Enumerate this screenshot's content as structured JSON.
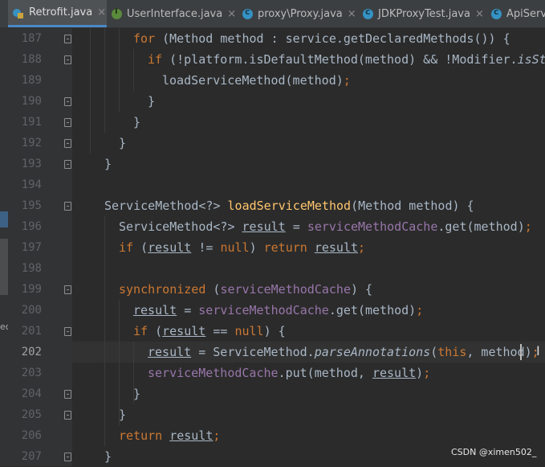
{
  "tabs": [
    {
      "label": "Retrofit.java",
      "active": true,
      "icon": "retrofit-class-icon",
      "closable": true
    },
    {
      "label": "UserInterface.java",
      "active": false,
      "icon": "interface-icon",
      "closable": true
    },
    {
      "label": "proxy\\Proxy.java",
      "active": false,
      "icon": "class-icon",
      "closable": true
    },
    {
      "label": "JDKProxyTest.java",
      "active": false,
      "icon": "class-icon",
      "closable": true
    },
    {
      "label": "ApiServ",
      "active": false,
      "icon": "class-icon",
      "closable": false
    }
  ],
  "left_strip": {
    "partial_text": "ec"
  },
  "editor": {
    "current_line": "202",
    "lines": [
      {
        "n": "187",
        "tokens": [
          {
            "t": "for",
            "c": "kw"
          },
          {
            "t": " (Method method : service.getDeclaredMethods()) {"
          }
        ]
      },
      {
        "n": "188",
        "tokens": [
          {
            "t": "if",
            "c": "kw"
          },
          {
            "t": " (!platform.isDefaultMethod(method) && !Modifier."
          },
          {
            "t": "isStat",
            "c": "stat"
          }
        ]
      },
      {
        "n": "189",
        "tokens": [
          {
            "t": "loadServiceMethod(method)"
          },
          {
            "t": ";",
            "c": "kw"
          }
        ]
      },
      {
        "n": "190",
        "tokens": [
          {
            "t": "}"
          }
        ]
      },
      {
        "n": "191",
        "tokens": [
          {
            "t": "}"
          }
        ]
      },
      {
        "n": "192",
        "tokens": [
          {
            "t": "}"
          }
        ]
      },
      {
        "n": "193",
        "tokens": [
          {
            "t": "}"
          }
        ]
      },
      {
        "n": "194",
        "tokens": []
      },
      {
        "n": "195",
        "tokens": [
          {
            "t": "ServiceMethod<?> "
          },
          {
            "t": "loadServiceMethod",
            "c": "mth"
          },
          {
            "t": "(Method method) {"
          }
        ]
      },
      {
        "n": "196",
        "tokens": [
          {
            "t": "ServiceMethod<?> "
          },
          {
            "t": "result",
            "c": "lv"
          },
          {
            "t": " = "
          },
          {
            "t": "serviceMethodCache",
            "c": "fld"
          },
          {
            "t": ".get(method)"
          },
          {
            "t": ";",
            "c": "kw"
          }
        ]
      },
      {
        "n": "197",
        "tokens": [
          {
            "t": "if",
            "c": "kw"
          },
          {
            "t": " ("
          },
          {
            "t": "result",
            "c": "lv"
          },
          {
            "t": " != "
          },
          {
            "t": "null",
            "c": "kw"
          },
          {
            "t": ") "
          },
          {
            "t": "return",
            "c": "kw"
          },
          {
            "t": " "
          },
          {
            "t": "result",
            "c": "lv"
          },
          {
            "t": ";",
            "c": "kw"
          }
        ]
      },
      {
        "n": "198",
        "tokens": []
      },
      {
        "n": "199",
        "tokens": [
          {
            "t": "synchronized",
            "c": "kw"
          },
          {
            "t": " ("
          },
          {
            "t": "serviceMethodCache",
            "c": "fld"
          },
          {
            "t": ") {"
          }
        ]
      },
      {
        "n": "200",
        "tokens": [
          {
            "t": "result",
            "c": "lv"
          },
          {
            "t": " = "
          },
          {
            "t": "serviceMethodCache",
            "c": "fld"
          },
          {
            "t": ".get(method)"
          },
          {
            "t": ";",
            "c": "kw"
          }
        ]
      },
      {
        "n": "201",
        "tokens": [
          {
            "t": "if",
            "c": "kw"
          },
          {
            "t": " ("
          },
          {
            "t": "result",
            "c": "lv"
          },
          {
            "t": " == "
          },
          {
            "t": "null",
            "c": "kw"
          },
          {
            "t": ") {"
          }
        ]
      },
      {
        "n": "202",
        "tokens": [
          {
            "t": "result",
            "c": "lv"
          },
          {
            "t": " = ServiceMethod."
          },
          {
            "t": "parseAnnotations",
            "c": "stat"
          },
          {
            "t": "("
          },
          {
            "t": "this",
            "c": "kw"
          },
          {
            "t": ", method)"
          },
          {
            "t": ";",
            "c": "kw"
          }
        ]
      },
      {
        "n": "203",
        "tokens": [
          {
            "t": "serviceMethodCache",
            "c": "fld"
          },
          {
            "t": ".put(method, "
          },
          {
            "t": "result",
            "c": "lv"
          },
          {
            "t": ")"
          },
          {
            "t": ";",
            "c": "kw"
          }
        ]
      },
      {
        "n": "204",
        "tokens": [
          {
            "t": "}"
          }
        ]
      },
      {
        "n": "205",
        "tokens": [
          {
            "t": "}"
          }
        ]
      },
      {
        "n": "206",
        "tokens": [
          {
            "t": "return",
            "c": "kw"
          },
          {
            "t": " "
          },
          {
            "t": "result",
            "c": "lv"
          },
          {
            "t": ";",
            "c": "kw"
          }
        ]
      },
      {
        "n": "207",
        "tokens": [
          {
            "t": "}"
          }
        ]
      }
    ]
  },
  "watermark": "CSDN @ximen502_",
  "colors": {
    "background": "#2b2b2b",
    "keyword": "#cc7832",
    "field": "#9876aa",
    "method_decl": "#ffc66d",
    "default_text": "#a9b7c6",
    "line_number": "#606366"
  }
}
